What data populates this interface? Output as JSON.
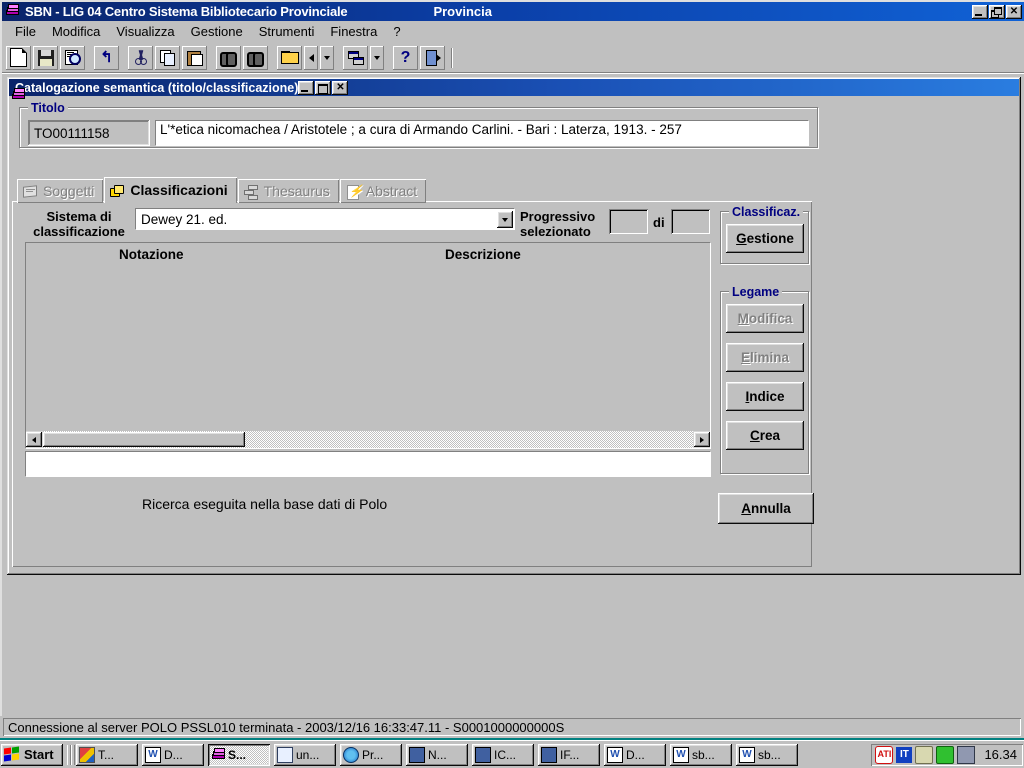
{
  "app": {
    "title": "SBN - LIG 04 Centro Sistema Bibliotecario Provinciale",
    "subtitle": "Provincia",
    "icon": "books-icon",
    "window_buttons": {
      "minimize": "minimize-icon",
      "restore": "restore-icon",
      "close": "close-icon"
    }
  },
  "menubar": {
    "items": [
      {
        "label": "File"
      },
      {
        "label": "Modifica"
      },
      {
        "label": "Visualizza"
      },
      {
        "label": "Gestione"
      },
      {
        "label": "Strumenti"
      },
      {
        "label": "Finestra"
      },
      {
        "label": "?"
      }
    ]
  },
  "toolbar": {
    "buttons": [
      {
        "name": "new-document-icon",
        "tip": "Nuovo"
      },
      {
        "name": "save-icon",
        "tip": "Salva"
      },
      {
        "name": "print-preview-icon",
        "tip": "Anteprima di stampa"
      },
      {
        "name": "undo-icon",
        "tip": "Annulla"
      },
      {
        "name": "cut-icon",
        "tip": "Taglia"
      },
      {
        "name": "copy-icon",
        "tip": "Copia"
      },
      {
        "name": "paste-icon",
        "tip": "Incolla"
      },
      {
        "name": "find-icon",
        "tip": "Cerca"
      },
      {
        "name": "find-advanced-icon",
        "tip": "Ricerca avanzata"
      },
      {
        "name": "open-folder-icon",
        "tip": "Apri"
      },
      {
        "name": "previous-record-icon",
        "tip": "Precedente"
      },
      {
        "name": "previous-dropdown-icon",
        "tip": "Elenco"
      },
      {
        "name": "cascade-windows-icon",
        "tip": "Finestre"
      },
      {
        "name": "cascade-dropdown-icon",
        "tip": "Elenco finestre"
      },
      {
        "name": "help-icon",
        "tip": "Guida"
      },
      {
        "name": "exit-icon",
        "tip": "Esci"
      }
    ]
  },
  "child_window": {
    "title": "Catalogazione semantica (titolo/classificazione)",
    "icon": "books-icon",
    "window_buttons": {
      "minimize": "minimize-icon",
      "restore": "restore-icon",
      "close": "close-icon"
    }
  },
  "titolo_group": {
    "legend": "Titolo",
    "id_value": "TO00111158",
    "description_value": "L'*etica nicomachea / Aristotele ; a cura di Armando Carlini. - Bari : Laterza, 1913. - 257"
  },
  "tabs": [
    {
      "label": "Soggetti",
      "icon": "subjects-icon",
      "active": false
    },
    {
      "label": "Classificazioni",
      "icon": "classifications-icon",
      "active": true
    },
    {
      "label": "Thesaurus",
      "icon": "thesaurus-icon",
      "active": false
    },
    {
      "label": "Abstract",
      "icon": "abstract-icon",
      "active": false
    }
  ],
  "classification_panel": {
    "system_label_line1": "Sistema di",
    "system_label_line2": "classificazione",
    "system_value": "Dewey 21. ed.",
    "progressive_label_line1": "Progressivo",
    "progressive_label_line2": "selezionato",
    "progressive_value": "",
    "di_label": "di",
    "total_value": "",
    "columns": [
      {
        "header": "Notazione"
      },
      {
        "header": "Descrizione"
      }
    ],
    "rows": [],
    "detail_value": "",
    "message": "Ricerca eseguita nella base dati di Polo"
  },
  "side_panel": {
    "classificaz_group": {
      "legend": "Classificaz.",
      "buttons": [
        {
          "label": "Gestione",
          "accel": "G",
          "disabled": false
        }
      ]
    },
    "legame_group": {
      "legend": "Legame",
      "buttons": [
        {
          "label": "Modifica",
          "accel": "M",
          "disabled": true
        },
        {
          "label": "Elimina",
          "accel": "E",
          "disabled": true
        },
        {
          "label": "Indice",
          "accel": "I",
          "disabled": false
        },
        {
          "label": "Crea",
          "accel": "C",
          "disabled": false
        }
      ]
    },
    "cancel_button": {
      "label": "Annulla",
      "accel": "A",
      "disabled": false
    }
  },
  "statusbar": {
    "text": "Connessione al server POLO PSSL010 terminata - 2003/12/16 16:33:47.11 - S0001000000000S"
  },
  "taskbar": {
    "start_label": "Start",
    "start_icon": "windows-flag-icon",
    "items": [
      {
        "label": "T...",
        "icon": "paint-icon",
        "active": false
      },
      {
        "label": "D...",
        "icon": "word-icon",
        "active": false
      },
      {
        "label": "S...",
        "icon": "books-icon",
        "active": true
      },
      {
        "label": "un...",
        "icon": "image-icon",
        "active": false
      },
      {
        "label": "Pr...",
        "icon": "explorer-icon",
        "active": false
      },
      {
        "label": "N...",
        "icon": "terminal-icon",
        "active": false
      },
      {
        "label": "IC...",
        "icon": "terminal-icon",
        "active": false
      },
      {
        "label": "IF...",
        "icon": "terminal-icon",
        "active": false
      },
      {
        "label": "D...",
        "icon": "word-icon",
        "active": false
      },
      {
        "label": "sb...",
        "icon": "word-icon",
        "active": false
      },
      {
        "label": "sb...",
        "icon": "word-icon",
        "active": false
      }
    ],
    "tray": [
      {
        "name": "ati-display-icon"
      },
      {
        "name": "language-it-icon",
        "label": "IT"
      },
      {
        "name": "plug-cable-icon"
      },
      {
        "name": "antivirus-icon"
      },
      {
        "name": "network-icon"
      }
    ],
    "clock": "16.34"
  },
  "colors": {
    "desktop": "#008080",
    "face": "#c0c0c0",
    "titlebar_active": "#0a246a",
    "group_legend": "#000080",
    "disabled_text": "#808080"
  }
}
